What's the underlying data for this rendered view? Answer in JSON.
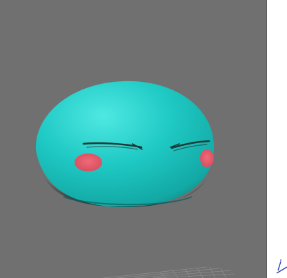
{
  "app": {
    "colors": {
      "viewport_background": "#707070",
      "model_body": "#1fc9c4",
      "model_blush": "#e35a6a",
      "eye_lines": "#1e3a38",
      "grid_lines": "#8c8c8c",
      "side_panel": "#ffffff",
      "side_panel_stroke": "#2a3fb0"
    },
    "viewport": {
      "content": "3d-slime-model",
      "features": [
        "squinting-eyes",
        "pink-cheeks"
      ],
      "grid_visible": true
    },
    "icons": {
      "side_panel_fragment": "partial-axis-gizmo-icon"
    }
  }
}
